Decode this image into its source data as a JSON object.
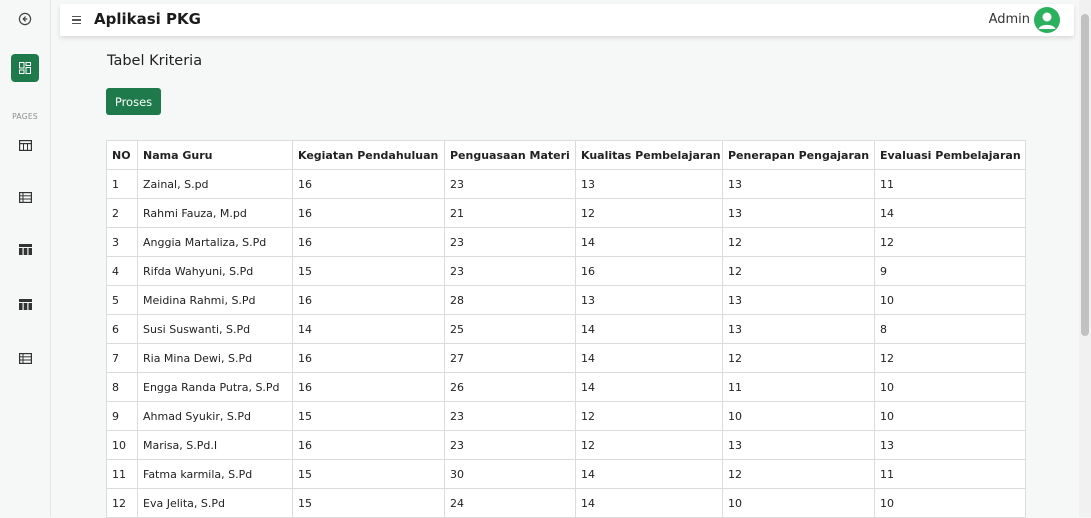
{
  "app": {
    "title": "Aplikasi PKG",
    "user": "Admin"
  },
  "sidebar": {
    "section_label": "PAGES",
    "items": [
      {
        "icon": "table-icon"
      },
      {
        "icon": "list-table-icon"
      },
      {
        "icon": "table-layout-icon"
      },
      {
        "icon": "table-layout-icon"
      },
      {
        "icon": "list-table-icon"
      }
    ]
  },
  "page": {
    "title": "Tabel Kriteria",
    "button_label": "Proses"
  },
  "table": {
    "headers": [
      "NO",
      "Nama Guru",
      "Kegiatan Pendahuluan",
      "Penguasaan Materi",
      "Kualitas Pembelajaran",
      "Penerapan Pengajaran",
      "Evaluasi Pembelajaran"
    ],
    "rows": [
      [
        "1",
        "Zainal, S.pd",
        "16",
        "23",
        "13",
        "13",
        "11"
      ],
      [
        "2",
        "Rahmi Fauza, M.pd",
        "16",
        "21",
        "12",
        "13",
        "14"
      ],
      [
        "3",
        "Anggia Martaliza, S.Pd",
        "16",
        "23",
        "14",
        "12",
        "12"
      ],
      [
        "4",
        "Rifda Wahyuni, S.Pd",
        "15",
        "23",
        "16",
        "12",
        "9"
      ],
      [
        "5",
        "Meidina Rahmi, S.Pd",
        "16",
        "28",
        "13",
        "13",
        "10"
      ],
      [
        "6",
        "Susi Suswanti, S.Pd",
        "14",
        "25",
        "14",
        "13",
        "8"
      ],
      [
        "7",
        "Ria Mina Dewi, S.Pd",
        "16",
        "27",
        "14",
        "12",
        "12"
      ],
      [
        "8",
        "Engga Randa Putra, S.Pd",
        "16",
        "26",
        "14",
        "11",
        "10"
      ],
      [
        "9",
        "Ahmad Syukir, S.Pd",
        "15",
        "23",
        "12",
        "10",
        "10"
      ],
      [
        "10",
        "Marisa, S.Pd.I",
        "16",
        "23",
        "12",
        "13",
        "13"
      ],
      [
        "11",
        "Fatma karmila, S.Pd",
        "15",
        "30",
        "14",
        "12",
        "11"
      ],
      [
        "12",
        "Eva Jelita, S.Pd",
        "15",
        "24",
        "14",
        "10",
        "10"
      ]
    ]
  },
  "colors": {
    "accent": "#1e7a4b",
    "avatar": "#2bb05e"
  }
}
